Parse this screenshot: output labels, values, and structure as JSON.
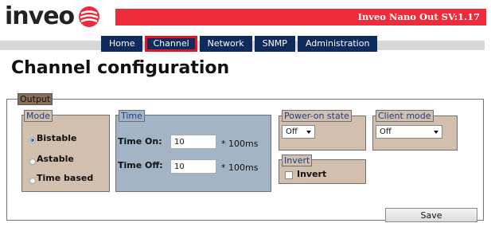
{
  "header": {
    "logo_text": "inveo",
    "device_title": "Inveo Nano Out SV:1.17",
    "brand_color": "#ee2b3b",
    "nav_color": "#0f2a5c"
  },
  "nav": {
    "items": [
      {
        "label": "Home"
      },
      {
        "label": "Channel",
        "active": true
      },
      {
        "label": "Network"
      },
      {
        "label": "SNMP"
      },
      {
        "label": "Administration"
      }
    ]
  },
  "page": {
    "title": "Channel configuration"
  },
  "output": {
    "legend": "Output",
    "mode": {
      "legend": "Mode",
      "options": [
        {
          "label": "Bistable",
          "checked": true
        },
        {
          "label": "Astable",
          "checked": false
        },
        {
          "label": "Time based",
          "checked": false
        }
      ]
    },
    "time": {
      "legend": "Time",
      "on_label": "Time On:",
      "on_value": "10",
      "off_label": "Time Off:",
      "off_value": "10",
      "unit": "* 100ms"
    },
    "power_on": {
      "legend": "Power-on state",
      "value": "Off"
    },
    "client_mode": {
      "legend": "Client mode",
      "value": "Off"
    },
    "invert": {
      "legend": "Invert",
      "label": "Invert",
      "checked": false
    }
  },
  "actions": {
    "save_label": "Save"
  }
}
